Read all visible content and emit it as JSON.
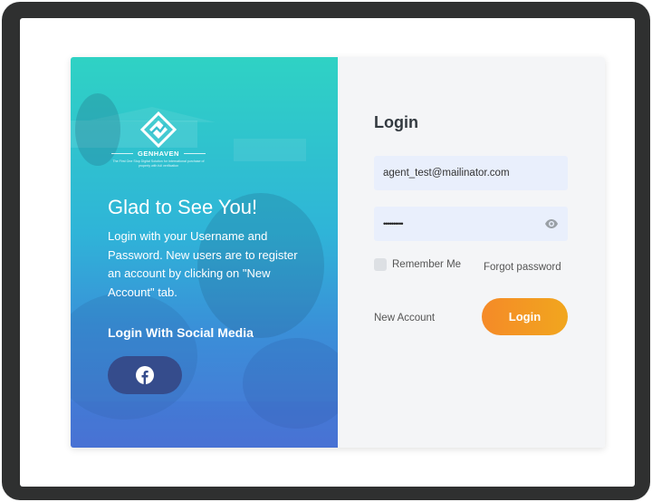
{
  "brand": {
    "name": "GENHAVEN",
    "tagline": "The First One Stop Digital Solution for International purchase of property with full verification"
  },
  "left_panel": {
    "greeting": "Glad to See You!",
    "intro": "Login with your Username and Password. New users are to register an account by clicking on \"New Account\" tab.",
    "social_heading": "Login With Social Media",
    "social_button_icon": "facebook-icon"
  },
  "login_form": {
    "title": "Login",
    "email_value": "agent_test@mailinator.com",
    "password_masked": "••••••••••",
    "password_toggle_icon": "eye-icon",
    "remember_label": "Remember Me",
    "remember_checked": false,
    "forgot_label": "Forgot password",
    "new_account_label": "New Account",
    "submit_label": "Login"
  },
  "colors": {
    "accent_gradient_start": "#f58a28",
    "accent_gradient_end": "#f1a61e",
    "panel_gradient_top": "#2fd2c4",
    "panel_gradient_bottom": "#4b74d6",
    "facebook_button": "#354c8c",
    "frame": "#2f3030"
  }
}
